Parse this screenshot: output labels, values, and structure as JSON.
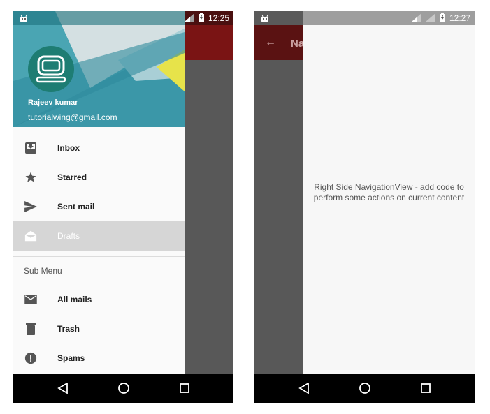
{
  "left_screen": {
    "status_time": "12:25",
    "user": {
      "name": "Rajeev kumar",
      "email": "tutorialwing@gmail.com"
    },
    "menu": [
      {
        "label": "Inbox",
        "icon": "inbox-icon"
      },
      {
        "label": "Starred",
        "icon": "star-icon"
      },
      {
        "label": "Sent mail",
        "icon": "send-icon"
      },
      {
        "label": "Drafts",
        "icon": "drafts-icon",
        "selected": true
      }
    ],
    "submenu_title": "Sub Menu",
    "submenu": [
      {
        "label": "All mails",
        "icon": "mail-icon"
      },
      {
        "label": "Trash",
        "icon": "trash-icon"
      },
      {
        "label": "Spams",
        "icon": "alert-icon"
      }
    ]
  },
  "right_screen": {
    "status_time": "12:27",
    "toolbar_partial": "Na",
    "drawer_text": "Right Side NavigationView - add code to perform some actions on current content"
  },
  "colors": {
    "toolbar": "#7a1414",
    "header_teal": "#3b97a8",
    "avatar": "#1e7d73",
    "selected_row": "#d6d6d6"
  }
}
